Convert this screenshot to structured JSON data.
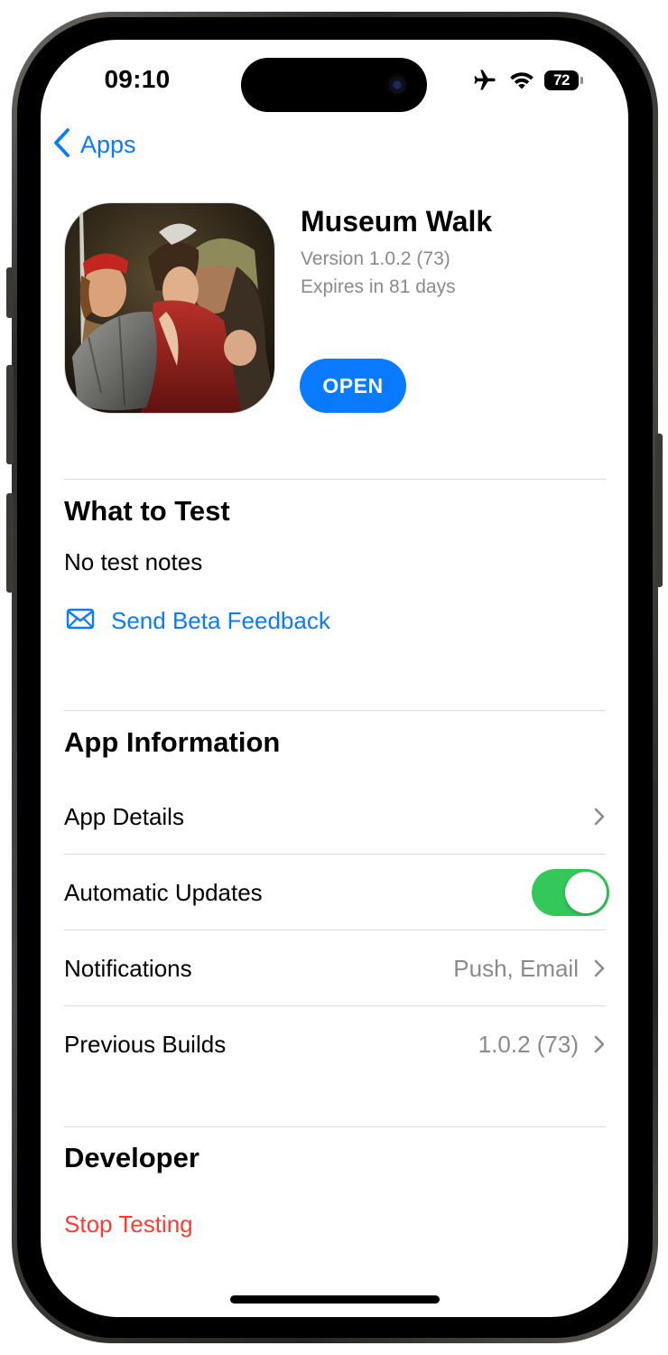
{
  "status_bar": {
    "time": "09:10",
    "battery_level": "72",
    "icons": [
      "airplane-icon",
      "wifi-icon",
      "battery-icon"
    ]
  },
  "nav": {
    "back_label": "Apps",
    "back_icon": "chevron-left-icon"
  },
  "app": {
    "name": "Museum Walk",
    "version": "Version 1.0.2 (73)",
    "expires": "Expires in 81 days",
    "open_label": "OPEN",
    "icon": "painting-thumbnail"
  },
  "what_to_test": {
    "title": "What to Test",
    "notes": "No test notes",
    "feedback_label": "Send Beta Feedback",
    "feedback_icon": "envelope-icon"
  },
  "app_information": {
    "title": "App Information",
    "rows": [
      {
        "label": "App Details",
        "value": "",
        "control": "chevron"
      },
      {
        "label": "Automatic Updates",
        "value": "",
        "control": "toggle",
        "toggle_on": true
      },
      {
        "label": "Notifications",
        "value": "Push, Email",
        "control": "chevron"
      },
      {
        "label": "Previous Builds",
        "value": "1.0.2 (73)",
        "control": "chevron"
      }
    ]
  },
  "developer": {
    "title": "Developer",
    "stop_label": "Stop Testing"
  },
  "colors": {
    "accent": "#0a7aff",
    "toggle_on": "#34c759",
    "destructive": "#ff3b30",
    "secondary_text": "#8a8a8e"
  }
}
